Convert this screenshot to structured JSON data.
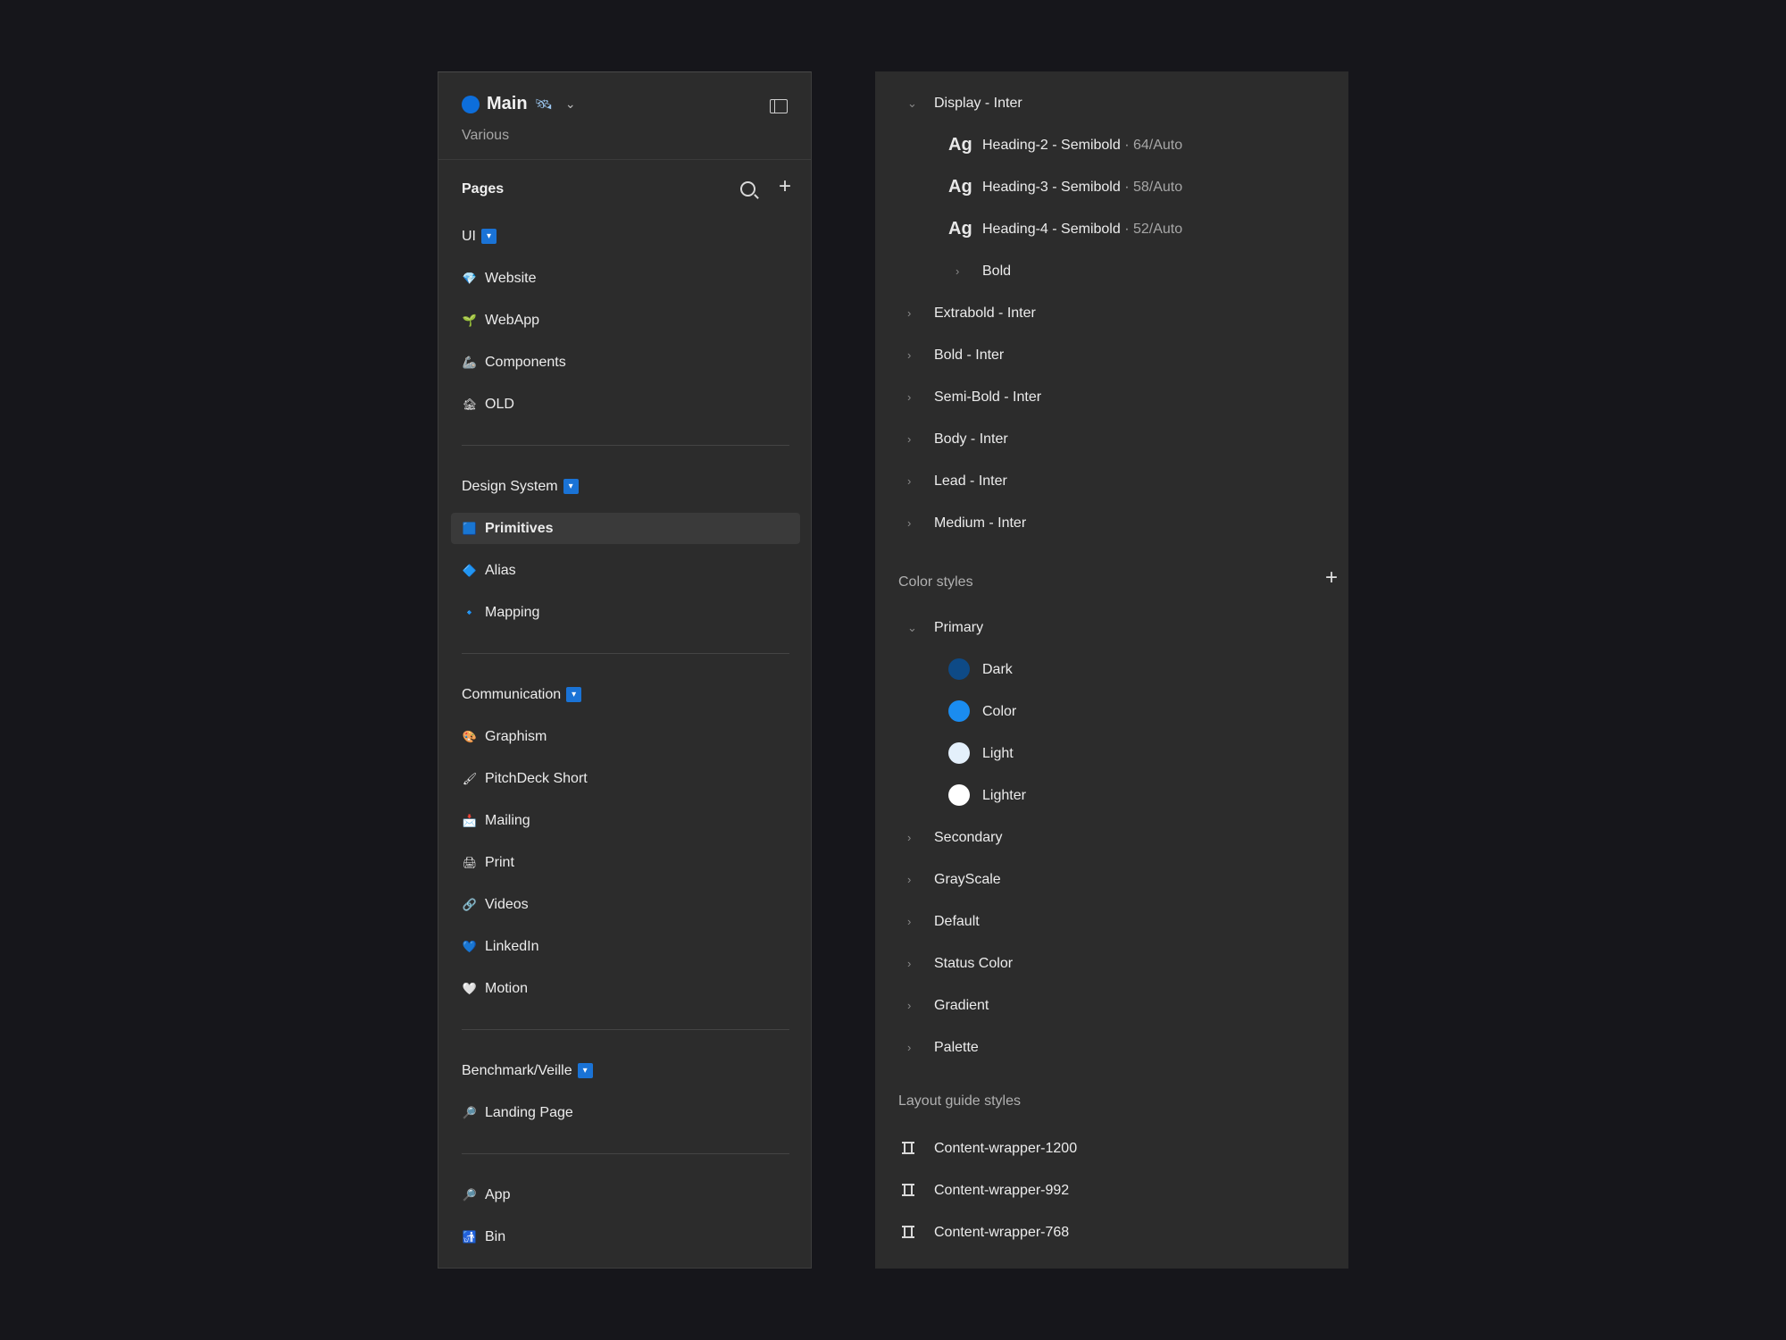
{
  "file": {
    "name": "Main",
    "emoji": "🛰",
    "subtitle": "Various"
  },
  "pages_label": "Pages",
  "sections": [
    {
      "title": "UI",
      "items": [
        {
          "icon": "💎",
          "label": "Website"
        },
        {
          "icon": "🌱",
          "label": "WebApp"
        },
        {
          "icon": "🦾",
          "label": "Components"
        },
        {
          "icon": "🏚",
          "label": "OLD"
        }
      ]
    },
    {
      "title": "Design System",
      "items": [
        {
          "icon": "🟦",
          "label": "Primitives",
          "selected": true
        },
        {
          "icon": "🔷",
          "label": "Alias"
        },
        {
          "icon": "🔹",
          "label": "Mapping"
        }
      ]
    },
    {
      "title": "Communication",
      "items": [
        {
          "icon": "🎨",
          "label": "Graphism"
        },
        {
          "icon": "🖌",
          "label": "PitchDeck Short"
        },
        {
          "icon": "📩",
          "label": "Mailing"
        },
        {
          "icon": "🖨",
          "label": "Print"
        },
        {
          "icon": "🔗",
          "label": "Videos"
        },
        {
          "icon": "💙",
          "label": "LinkedIn"
        },
        {
          "icon": "🤍",
          "label": "Motion"
        }
      ]
    },
    {
      "title": "Benchmark/Veille",
      "items": [
        {
          "icon": "🔎",
          "label": "Landing Page"
        }
      ]
    },
    {
      "title": "",
      "items": [
        {
          "icon": "🔎",
          "label": "App"
        },
        {
          "icon": "🚮",
          "label": "Bin"
        }
      ]
    }
  ],
  "text_styles": {
    "open_group": "Display - Inter",
    "styles": [
      {
        "name": "Heading-2 - Semibold",
        "spec": " · 64/Auto"
      },
      {
        "name": "Heading-3 - Semibold",
        "spec": " · 58/Auto"
      },
      {
        "name": "Heading-4 - Semibold",
        "spec": " · 52/Auto"
      }
    ],
    "subgroup": "Bold",
    "groups": [
      "Extrabold - Inter",
      "Bold - Inter",
      "Semi-Bold - Inter",
      "Body - Inter",
      "Lead - Inter",
      "Medium - Inter"
    ]
  },
  "color_styles": {
    "label": "Color styles",
    "open_group": "Primary",
    "swatches": [
      {
        "name": "Dark",
        "color": "#0e4a86"
      },
      {
        "name": "Color",
        "color": "#1a8cf0"
      },
      {
        "name": "Light",
        "color": "#e4f0fb"
      },
      {
        "name": "Lighter",
        "color": "#ffffff"
      }
    ],
    "groups": [
      "Secondary",
      "GrayScale",
      "Default",
      "Status Color",
      "Gradient",
      "Palette"
    ]
  },
  "layout_guides": {
    "label": "Layout guide styles",
    "items": [
      "Content-wrapper-1200",
      "Content-wrapper-992",
      "Content-wrapper-768"
    ]
  }
}
